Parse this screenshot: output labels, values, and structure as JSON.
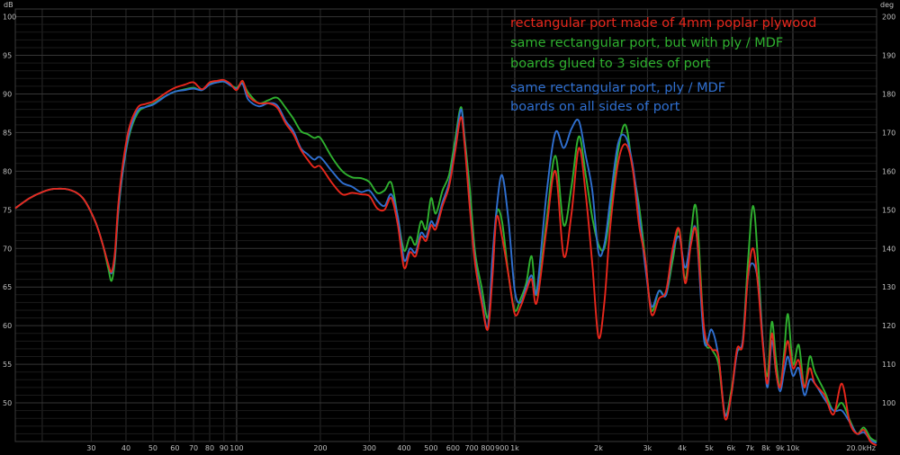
{
  "chart_data": {
    "type": "line",
    "title": "",
    "xlabel": "",
    "ylabel": "dB",
    "y2label": "deg",
    "x_scale": "log",
    "xlim": [
      16,
      20000
    ],
    "ylim": [
      45,
      101
    ],
    "y2lim": [
      90,
      202
    ],
    "grid": true,
    "background": "#000000",
    "x_ticks": [
      30,
      40,
      50,
      60,
      70,
      80,
      90,
      100,
      200,
      300,
      400,
      500,
      600,
      700,
      800,
      900,
      1000,
      2000,
      3000,
      4000,
      5000,
      6000,
      7000,
      8000,
      9000,
      10000,
      20000
    ],
    "x_tick_labels": [
      "30",
      "40",
      "50",
      "60",
      "70",
      "80",
      "90",
      "100",
      "200",
      "300",
      "400",
      "500",
      "600",
      "700",
      "800",
      "900",
      "1k",
      "2k",
      "3k",
      "4k",
      "5k",
      "6k",
      "7k",
      "8k",
      "9k",
      "10k",
      "20.0kHz"
    ],
    "y_ticks": [
      50,
      55,
      60,
      65,
      70,
      75,
      80,
      85,
      90,
      95,
      100
    ],
    "y_tick_labels": [
      "50",
      "55",
      "60",
      "65",
      "70",
      "75",
      "80",
      "85",
      "90",
      "95",
      "100"
    ],
    "y2_ticks": [
      100,
      110,
      120,
      130,
      140,
      150,
      160,
      170,
      180,
      190,
      200
    ],
    "y2_tick_labels": [
      "100",
      "110",
      "120",
      "130",
      "140",
      "150",
      "160",
      "170",
      "180",
      "190",
      "200"
    ],
    "legend_position": "top-right",
    "legend": [
      {
        "lines": [
          "rectangular port made of 4mm poplar plywood"
        ],
        "color": "#e8271c"
      },
      {
        "lines": [
          "same rectangular port, but with    ply / MDF",
          "boards glued to 3 sides of port"
        ],
        "color": "#2fb12f"
      },
      {
        "lines": [
          "same rectangular port,    ply / MDF",
          "boards on all sides of port"
        ],
        "color": "#2f6fd0"
      }
    ],
    "series": [
      {
        "color": "#2fb12f",
        "x": [
          16,
          18,
          20,
          22,
          25,
          28,
          31,
          33,
          34.5,
          35.5,
          36.5,
          37.5,
          39,
          41,
          44,
          47,
          50,
          53,
          56,
          60,
          65,
          70,
          75,
          80,
          85,
          90,
          95,
          100,
          105,
          110,
          120,
          130,
          140,
          150,
          160,
          170,
          180,
          190,
          200,
          220,
          240,
          260,
          280,
          300,
          320,
          340,
          360,
          380,
          400,
          420,
          440,
          460,
          480,
          500,
          520,
          550,
          580,
          610,
          640,
          660,
          690,
          720,
          760,
          800,
          830,
          860,
          900,
          950,
          1000,
          1050,
          1100,
          1150,
          1200,
          1300,
          1400,
          1500,
          1600,
          1700,
          1800,
          1900,
          2000,
          2100,
          2200,
          2350,
          2500,
          2650,
          2800,
          2950,
          3100,
          3300,
          3500,
          3700,
          3900,
          4100,
          4300,
          4500,
          4800,
          5100,
          5400,
          5700,
          6000,
          6300,
          6600,
          6900,
          7200,
          7500,
          7800,
          8100,
          8400,
          8700,
          9000,
          9300,
          9600,
          10000,
          10500,
          11000,
          11500,
          12000,
          13000,
          14000,
          15000,
          16000,
          17000,
          18000,
          19000,
          20000
        ],
        "y": [
          75.2,
          76.5,
          77.3,
          77.7,
          77.6,
          76.5,
          73.5,
          70.5,
          67.5,
          65.8,
          68.5,
          74.5,
          80.0,
          84.5,
          87.5,
          88.3,
          88.7,
          89.3,
          89.8,
          90.3,
          90.6,
          90.8,
          90.5,
          91.3,
          91.5,
          91.6,
          91.2,
          90.8,
          91.5,
          90.2,
          88.8,
          89.2,
          89.5,
          88.2,
          86.8,
          85.2,
          84.8,
          84.3,
          84.3,
          81.8,
          80.0,
          79.2,
          79.1,
          78.6,
          77.2,
          77.5,
          78.5,
          74.0,
          69.7,
          71.5,
          70.5,
          73.5,
          72.5,
          76.5,
          74.5,
          77.5,
          79.5,
          84.0,
          88.3,
          84.5,
          77.5,
          69.5,
          65.0,
          61.0,
          66.5,
          74.5,
          73.5,
          66.5,
          62.0,
          63.5,
          65.5,
          69.0,
          64.0,
          73.5,
          82.0,
          73.0,
          78.0,
          84.5,
          79.5,
          74.0,
          70.5,
          70.0,
          74.5,
          82.5,
          86.0,
          80.5,
          75.5,
          68.5,
          62.0,
          64.5,
          64.0,
          68.5,
          72.5,
          66.0,
          72.0,
          75.0,
          59.0,
          57.0,
          55.0,
          48.5,
          51.5,
          56.5,
          58.0,
          68.5,
          75.5,
          68.0,
          58.0,
          53.5,
          60.5,
          55.5,
          52.0,
          56.5,
          61.5,
          55.0,
          57.5,
          52.0,
          56.0,
          54.0,
          51.5,
          49.0,
          50.0,
          47.8,
          46.0,
          46.8,
          45.5,
          45.0
        ]
      },
      {
        "color": "#2f6fd0",
        "x": [
          16,
          18,
          20,
          22,
          25,
          28,
          31,
          33,
          34.5,
          35.5,
          36.5,
          37.5,
          39,
          41,
          44,
          47,
          50,
          53,
          56,
          60,
          65,
          70,
          75,
          80,
          85,
          90,
          95,
          100,
          105,
          110,
          120,
          130,
          140,
          150,
          160,
          170,
          180,
          190,
          200,
          220,
          240,
          260,
          280,
          300,
          320,
          340,
          360,
          380,
          400,
          420,
          440,
          460,
          480,
          500,
          520,
          550,
          580,
          610,
          640,
          660,
          690,
          720,
          760,
          800,
          830,
          860,
          900,
          950,
          1000,
          1050,
          1100,
          1150,
          1200,
          1300,
          1400,
          1500,
          1600,
          1700,
          1800,
          1900,
          2000,
          2100,
          2200,
          2350,
          2500,
          2650,
          2800,
          2950,
          3100,
          3300,
          3500,
          3700,
          3900,
          4100,
          4300,
          4500,
          4800,
          5100,
          5400,
          5700,
          6000,
          6300,
          6600,
          6900,
          7200,
          7500,
          7800,
          8100,
          8400,
          8700,
          9000,
          9300,
          9600,
          10000,
          10500,
          11000,
          11500,
          12000,
          13000,
          14000,
          15000,
          16000,
          17000,
          18000,
          19000,
          20000
        ],
        "y": [
          75.2,
          76.5,
          77.3,
          77.7,
          77.6,
          76.5,
          73.5,
          70.5,
          68.0,
          66.8,
          69.0,
          74.8,
          80.2,
          84.8,
          87.8,
          88.3,
          88.6,
          89.2,
          89.8,
          90.3,
          90.5,
          90.7,
          90.5,
          91.2,
          91.5,
          91.6,
          91.1,
          90.7,
          91.3,
          89.3,
          88.4,
          88.8,
          88.5,
          86.5,
          85.2,
          83.0,
          82.2,
          81.5,
          81.8,
          80.0,
          78.5,
          78.0,
          77.3,
          77.5,
          76.2,
          75.5,
          77.0,
          74.0,
          68.5,
          70.0,
          69.5,
          72.0,
          71.5,
          73.5,
          73.0,
          76.0,
          78.5,
          83.0,
          88.0,
          84.0,
          75.5,
          68.5,
          63.5,
          59.8,
          68.5,
          75.0,
          79.5,
          73.5,
          64.5,
          63.0,
          65.0,
          66.5,
          64.5,
          77.0,
          85.0,
          83.0,
          85.5,
          86.5,
          82.0,
          77.5,
          69.5,
          70.5,
          76.0,
          83.5,
          84.5,
          81.0,
          74.5,
          67.5,
          62.5,
          64.5,
          64.0,
          69.5,
          71.5,
          67.5,
          71.0,
          72.0,
          58.0,
          59.5,
          56.0,
          48.5,
          51.0,
          56.5,
          58.0,
          66.5,
          68.0,
          65.5,
          58.0,
          52.0,
          58.0,
          54.0,
          51.5,
          54.0,
          56.0,
          53.5,
          54.5,
          51.0,
          53.0,
          52.5,
          50.5,
          49.0,
          49.0,
          47.5,
          46.0,
          46.2,
          45.2,
          44.8
        ]
      },
      {
        "color": "#e8271c",
        "x": [
          16,
          18,
          20,
          22,
          25,
          28,
          31,
          33,
          34.5,
          35.5,
          36.5,
          37.5,
          39,
          41,
          44,
          47,
          50,
          53,
          56,
          60,
          65,
          70,
          75,
          80,
          85,
          90,
          95,
          100,
          105,
          110,
          120,
          130,
          140,
          150,
          160,
          170,
          180,
          190,
          200,
          220,
          240,
          260,
          280,
          300,
          320,
          340,
          360,
          380,
          400,
          420,
          440,
          460,
          480,
          500,
          520,
          550,
          580,
          610,
          640,
          660,
          690,
          720,
          760,
          800,
          830,
          860,
          900,
          950,
          1000,
          1050,
          1100,
          1150,
          1200,
          1300,
          1400,
          1500,
          1600,
          1700,
          1800,
          1900,
          2000,
          2100,
          2200,
          2350,
          2500,
          2650,
          2800,
          2950,
          3100,
          3300,
          3500,
          3700,
          3900,
          4100,
          4300,
          4500,
          4800,
          5100,
          5400,
          5700,
          6000,
          6300,
          6600,
          6900,
          7200,
          7500,
          7800,
          8100,
          8400,
          8700,
          9000,
          9300,
          9600,
          10000,
          10500,
          11000,
          11500,
          12000,
          13000,
          14000,
          15000,
          16000,
          17000,
          18000,
          19000,
          20000
        ],
        "y": [
          75.2,
          76.5,
          77.3,
          77.7,
          77.6,
          76.5,
          73.5,
          70.5,
          68.0,
          67.0,
          69.5,
          75.5,
          81.0,
          85.5,
          88.2,
          88.7,
          89.0,
          89.6,
          90.2,
          90.8,
          91.2,
          91.5,
          90.6,
          91.5,
          91.7,
          91.8,
          91.3,
          90.5,
          91.7,
          89.8,
          88.8,
          88.8,
          88.2,
          86.2,
          84.8,
          82.8,
          81.5,
          80.5,
          80.6,
          78.5,
          77.0,
          77.2,
          77.0,
          76.8,
          75.2,
          75.0,
          76.5,
          73.0,
          67.5,
          69.5,
          69.0,
          71.5,
          71.0,
          73.0,
          72.5,
          75.5,
          78.0,
          82.5,
          87.0,
          83.5,
          75.0,
          68.0,
          63.0,
          59.5,
          66.0,
          74.0,
          71.5,
          66.5,
          61.5,
          62.5,
          64.5,
          66.0,
          63.0,
          72.5,
          80.0,
          69.0,
          74.5,
          83.0,
          77.0,
          68.0,
          58.5,
          63.0,
          72.5,
          81.0,
          83.5,
          80.5,
          73.0,
          68.5,
          61.5,
          63.5,
          64.5,
          70.0,
          72.5,
          65.5,
          70.5,
          72.0,
          59.5,
          57.0,
          56.0,
          48.0,
          51.0,
          57.0,
          57.5,
          66.5,
          70.0,
          65.0,
          57.5,
          52.5,
          59.0,
          54.0,
          52.0,
          55.5,
          58.0,
          54.5,
          55.5,
          52.0,
          54.5,
          52.5,
          51.0,
          48.5,
          52.5,
          47.5,
          46.0,
          46.5,
          45.0,
          44.5
        ]
      }
    ]
  }
}
